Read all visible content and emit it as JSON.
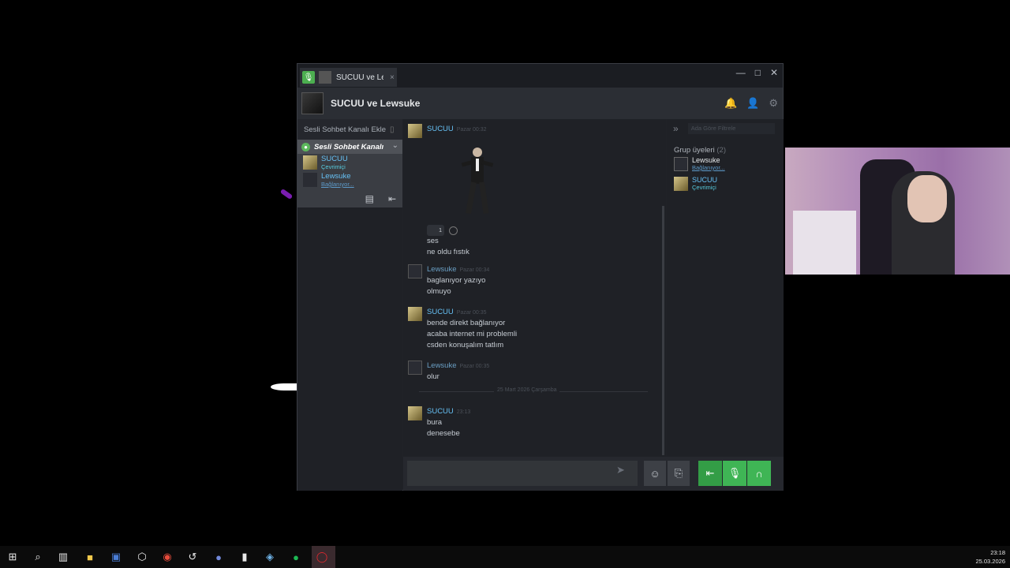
{
  "window": {
    "tab_title": "SUCUU ve Le",
    "tab_close": "×",
    "minimize": "—",
    "maximize": "□",
    "close": "✕",
    "header_title": "SUCUU ve Lewsuke"
  },
  "voice_panel": {
    "add_channel": "Sesli Sohbet Kanalı Ekle",
    "channel_name": "Sesli Sohbet Kanalı",
    "users": [
      {
        "name": "SUCUU",
        "status": "Çevrimiçi"
      },
      {
        "name": "Lewsuke",
        "status": "Bağlanıyor..."
      }
    ]
  },
  "messages": [
    {
      "author": "SUCUU",
      "time": "Pazar 00:32",
      "reaction_count": "1",
      "lines": [
        "ses",
        "ne oldu fıstık"
      ]
    },
    {
      "author": "Lewsuke",
      "time": "Pazar 00:34",
      "lines": [
        "baglanıyor yazıyo",
        "olmuyo"
      ]
    },
    {
      "author": "SUCUU",
      "time": "Pazar 00:35",
      "lines": [
        "bende direkt bağlanıyor",
        "acaba internet mi problemli",
        "csden konuşalım tatlım"
      ]
    },
    {
      "author": "Lewsuke",
      "time": "Pazar 00:35",
      "lines": [
        "olur"
      ]
    },
    {
      "author": "SUCUU",
      "time": "23:13",
      "lines": [
        "bura",
        "denesebe"
      ]
    }
  ],
  "date_divider": "25 Mart 2026 Çarşamba",
  "members": {
    "filter_placeholder": "Ada Göre Filtrele",
    "group_label": "Grup üyeleri",
    "group_count": "(2)",
    "list": [
      {
        "name": "Lewsuke",
        "status": "Bağlanıyor..."
      },
      {
        "name": "SUCUU",
        "status": "Çevrimiçi"
      }
    ]
  },
  "taskbar": {
    "time": "23:18",
    "date": "25.03.2026"
  },
  "colors": {
    "accent_green": "#3fb555",
    "name_blue": "#66c0f4"
  }
}
